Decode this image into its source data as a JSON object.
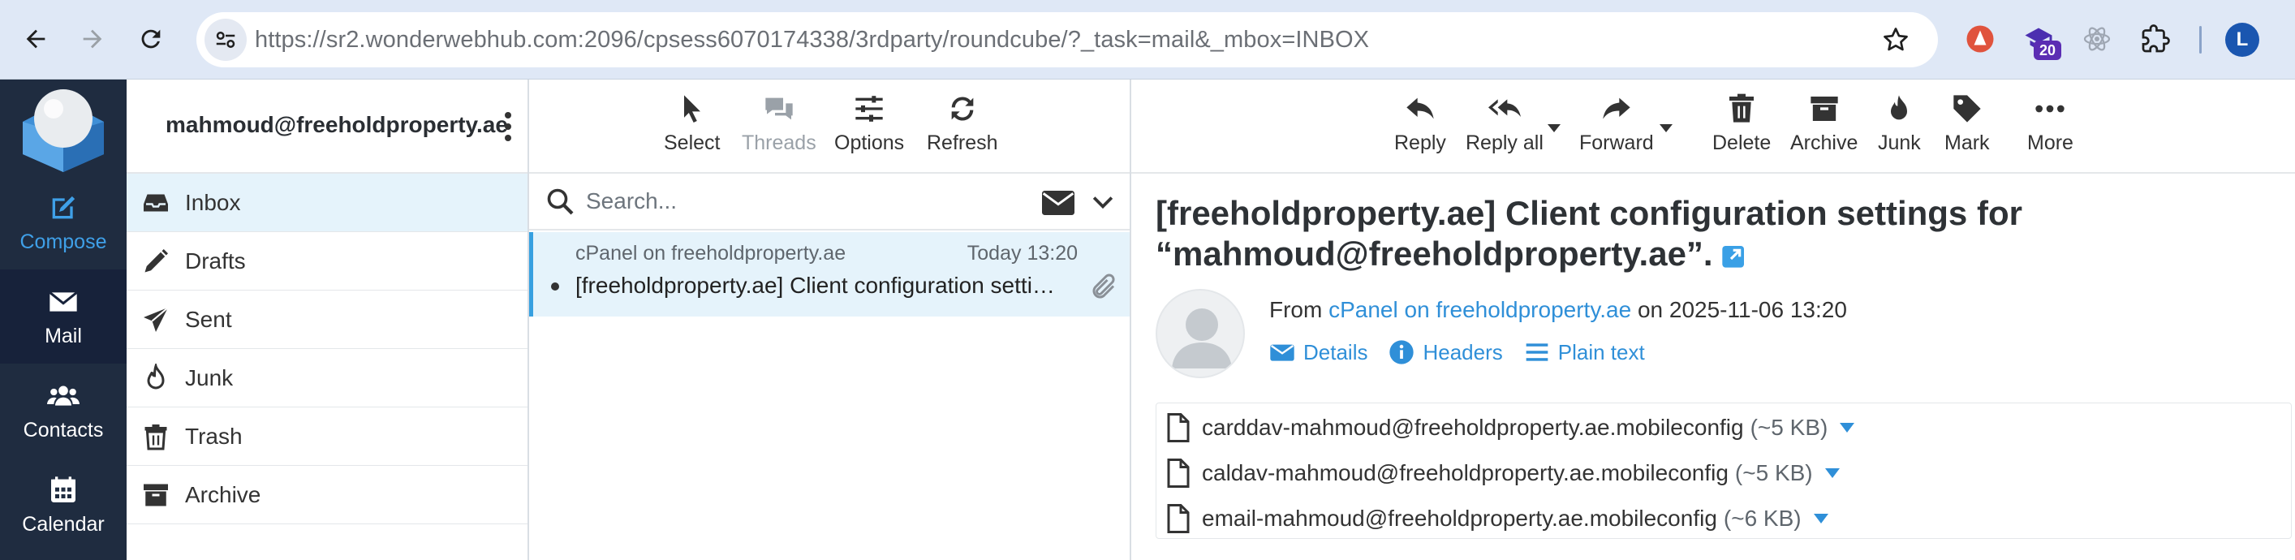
{
  "browser": {
    "url_host": "https://sr2.wonderwebhub.com",
    "url_rest": ":2096/cpsess6070174338/3rdparty/roundcube/?_task=mail&_mbox=INBOX",
    "extension_badge": "20",
    "profile_initial": "L"
  },
  "appnav": {
    "items": [
      {
        "label": "Compose",
        "icon": "compose-icon"
      },
      {
        "label": "Mail",
        "icon": "envelope-icon"
      },
      {
        "label": "Contacts",
        "icon": "contacts-icon"
      },
      {
        "label": "Calendar",
        "icon": "calendar-icon"
      }
    ]
  },
  "folders": {
    "account": "mahmoud@freeholdproperty.ae",
    "items": [
      {
        "label": "Inbox",
        "icon": "inbox-icon"
      },
      {
        "label": "Drafts",
        "icon": "pencil-icon"
      },
      {
        "label": "Sent",
        "icon": "paper-plane-icon"
      },
      {
        "label": "Junk",
        "icon": "fire-icon"
      },
      {
        "label": "Trash",
        "icon": "trash-icon"
      },
      {
        "label": "Archive",
        "icon": "archive-icon"
      }
    ]
  },
  "list_toolbar": {
    "select": "Select",
    "threads": "Threads",
    "options": "Options",
    "refresh": "Refresh"
  },
  "search": {
    "placeholder": "Search..."
  },
  "messages": [
    {
      "from": "cPanel on freeholdproperty.ae",
      "date": "Today 13:20",
      "subject": "[freeholdproperty.ae] Client configuration settings for “mahmoud@freeholdproperty.ae”."
    }
  ],
  "preview_toolbar": {
    "reply": "Reply",
    "reply_all": "Reply all",
    "forward": "Forward",
    "delete": "Delete",
    "archive": "Archive",
    "junk": "Junk",
    "mark": "Mark",
    "more": "More"
  },
  "message": {
    "subject": "[freeholdproperty.ae] Client configuration settings for “mahmoud@freeholdproperty.ae”.",
    "from_prefix": "From",
    "from_name": "cPanel on freeholdproperty.ae",
    "from_suffix": "on 2025-11-06 13:20",
    "links": {
      "details": "Details",
      "headers": "Headers",
      "plain_text": "Plain text"
    },
    "attachments": [
      {
        "name": "carddav-mahmoud@freeholdproperty.ae.mobileconfig",
        "size": "(~5 KB)"
      },
      {
        "name": "caldav-mahmoud@freeholdproperty.ae.mobileconfig",
        "size": "(~5 KB)"
      },
      {
        "name": "email-mahmoud@freeholdproperty.ae.mobileconfig",
        "size": "(~6 KB)"
      }
    ]
  },
  "colors": {
    "nav_bg": "#1f2c40",
    "accent": "#37a0e0",
    "selected_bg": "#e5f3fb"
  }
}
